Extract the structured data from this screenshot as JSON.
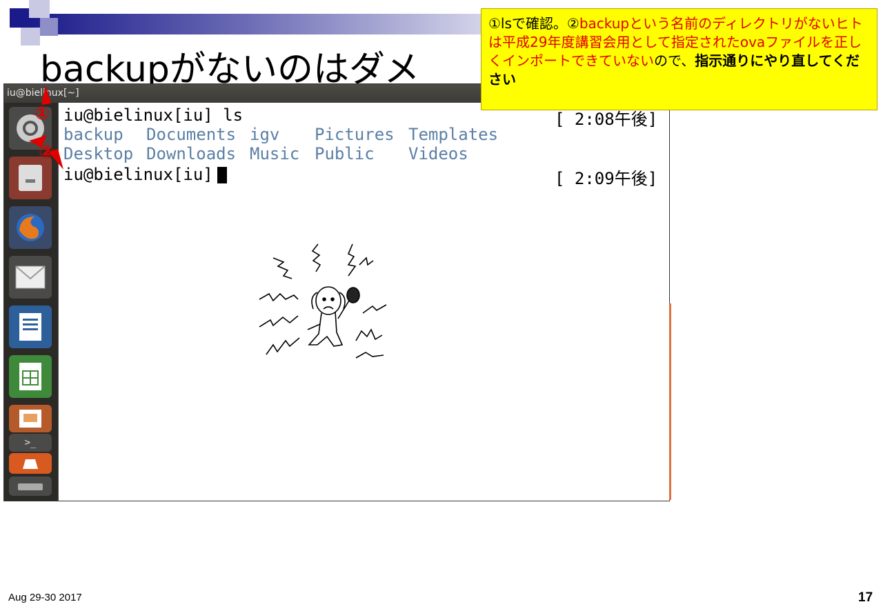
{
  "slide": {
    "title": "backupがないのはダメ",
    "date": "Aug 29-30 2017",
    "page_number": "17"
  },
  "window": {
    "title": "iu@bielinux[~]"
  },
  "callout": {
    "part1": "①lsで確認。②",
    "part2": "backupという名前のディレクトリがないヒトは平成29年度講習会用として指定されたovaファイルを正しくインポートできていない",
    "part3": "ので、",
    "part4": "指示通りにやり直してください"
  },
  "markers": {
    "one": "①",
    "two": "②"
  },
  "terminal": {
    "line1_prompt": "iu@bielinux[iu] ls",
    "line1_time": "[ 2:08午後]",
    "ls_row1": [
      "backup",
      "Documents",
      "igv",
      "Pictures",
      "Templates"
    ],
    "ls_row2": [
      "Desktop",
      "Downloads",
      "Music",
      "Public",
      "Videos"
    ],
    "line3_prompt": "iu@bielinux[iu]",
    "line3_time": "[ 2:09午後]"
  },
  "launcher": {
    "items": [
      "ubuntu-dash-icon",
      "files-icon",
      "firefox-icon",
      "mail-icon",
      "writer-icon",
      "calc-icon",
      "impress-icon",
      "terminal-icon",
      "software-center-icon",
      "drive-icon"
    ]
  },
  "colors": {
    "callout_bg": "#ffff00",
    "callout_red": "#e00000",
    "dir_blue": "#5b7fa5"
  }
}
